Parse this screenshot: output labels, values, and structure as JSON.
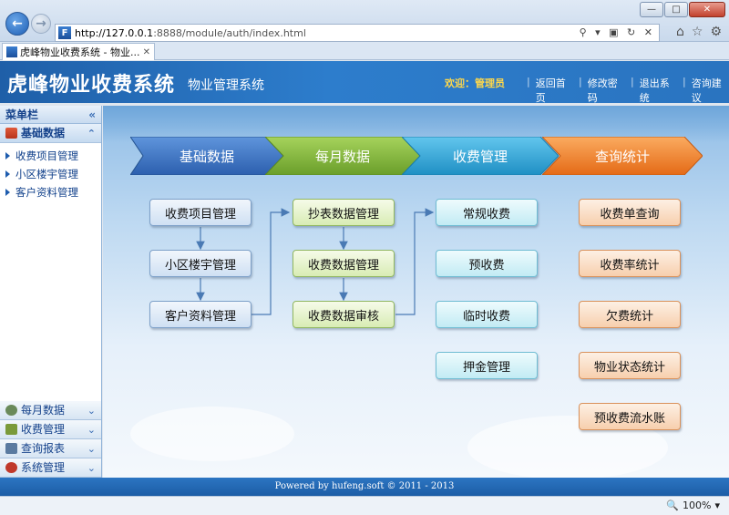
{
  "browser": {
    "url_host": "http://127.0.0.1",
    "url_path": ":8888/module/auth/index.html",
    "tab_title": "虎峰物业收费系统 - 物业...",
    "zoom": "100%"
  },
  "header": {
    "title": "虎峰物业收费系统",
    "subtitle": "物业管理系统",
    "welcome": "欢迎：管理员",
    "links": [
      "返回首页",
      "修改密码",
      "退出系统",
      "咨询建议"
    ]
  },
  "sidebar": {
    "title": "菜单栏",
    "active_group": "基础数据",
    "items": [
      "收费项目管理",
      "小区楼宇管理",
      "客户资料管理"
    ],
    "groups": [
      {
        "label": "每月数据",
        "icon": "calendar-icon",
        "color": "#6a8a5a"
      },
      {
        "label": "收费管理",
        "icon": "money-icon",
        "color": "#7a9a3a"
      },
      {
        "label": "查询报表",
        "icon": "report-icon",
        "color": "#5a7aa0"
      },
      {
        "label": "系统管理",
        "icon": "system-icon",
        "color": "#c0392b"
      }
    ]
  },
  "flow": {
    "stages": [
      {
        "label": "基础数据",
        "color": "#3b73c4"
      },
      {
        "label": "每月数据",
        "color": "#7fb83a"
      },
      {
        "label": "收费管理",
        "color": "#2fa5d8"
      },
      {
        "label": "查询统计",
        "color": "#f07f2a"
      }
    ],
    "col1": [
      "收费项目管理",
      "小区楼宇管理",
      "客户资料管理"
    ],
    "col2": [
      "抄表数据管理",
      "收费数据管理",
      "收费数据审核"
    ],
    "col3": [
      "常规收费",
      "预收费",
      "临时收费",
      "押金管理"
    ],
    "col4": [
      "收费单查询",
      "收费率统计",
      "欠费统计",
      "物业状态统计",
      "预收费流水账"
    ]
  },
  "footer": "Powered by hufeng.soft © 2011 - 2013"
}
